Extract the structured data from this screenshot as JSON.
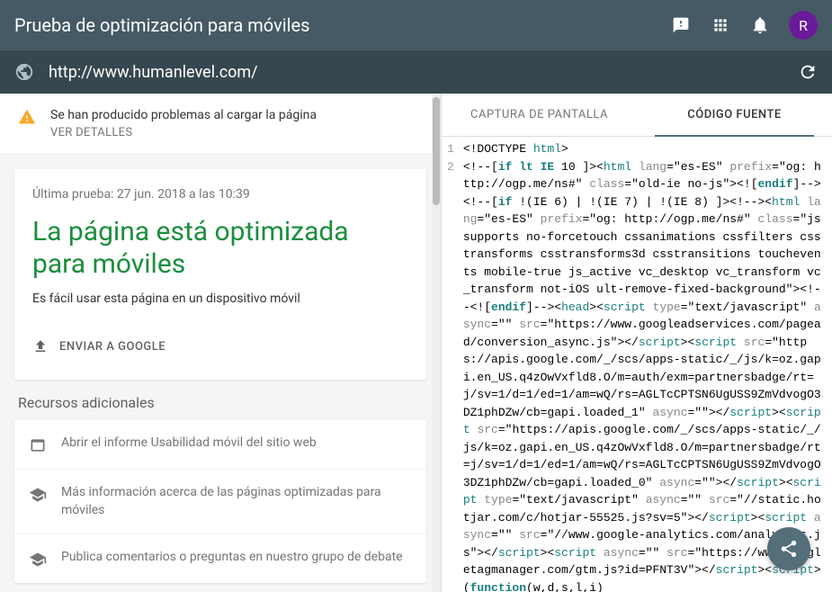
{
  "header": {
    "title": "Prueba de optimización para móviles",
    "avatar_letter": "R"
  },
  "url_bar": {
    "url": "http://www.humanlevel.com/"
  },
  "warning": {
    "message": "Se han producido problemas al cargar la página",
    "link": "VER DETALLES"
  },
  "result": {
    "timestamp": "Última prueba: 27 jun. 2018 a las 10:39",
    "title": "La página está optimizada para móviles",
    "description": "Es fácil usar esta página en un dispositivo móvil",
    "submit_label": "ENVIAR A GOOGLE"
  },
  "resources": {
    "title": "Recursos adicionales",
    "items": [
      "Abrir el informe Usabilidad móvil del sitio web",
      "Más información acerca de las páginas optimizadas para móviles",
      "Publica comentarios o preguntas en nuestro grupo de debate"
    ]
  },
  "tabs": {
    "screenshot": "CAPTURA DE PANTALLA",
    "source": "CÓDIGO FUENTE"
  },
  "code": {
    "lines": [
      "1",
      "2"
    ],
    "content_html": "&lt;!DOCTYPE <span class='tag'>html</span>&gt;<br>&lt;!--[<span class='keyword'>if lt IE</span> 10 ]&gt;&lt;<span class='tag'>html</span> <span class='attr'>lang</span>=\"es-ES\" <span class='attr'>prefix</span>=\"og: http://ogp.me/ns#\" <span class='attr'>class</span>=\"old-ie no-js\"&gt;&lt;![<span class='keyword'>endif</span>]--&gt;&lt;!--[<span class='keyword'>if</span> !(IE 6) | !(IE 7) | !(IE 8) ]&gt;&lt;!--&gt;&lt;<span class='tag'>html</span> <span class='attr'>lang</span>=\"es-ES\" <span class='attr'>prefix</span>=\"og: http://ogp.me/ns#\" <span class='attr'>class</span>=\"js supports no-forcetouch cssanimations cssfilters csstransforms csstransforms3d csstransitions touchevents mobile-true js_active vc_desktop vc_transform vc_transform not-iOS ult-remove-fixed-background\"&gt;&lt;!--&lt;![<span class='keyword'>endif</span>]--&gt;&lt;<span class='tag'>head</span>&gt;&lt;<span class='tag'>script</span> <span class='attr'>type</span>=\"text/javascript\" <span class='attr'>async</span>=\"\" <span class='attr'>src</span>=\"https://www.googleadservices.com/pagead/conversion_async.js\"&gt;&lt;/<span class='tag'>script</span>&gt;&lt;<span class='tag'>script</span> <span class='attr'>src</span>=\"https://apis.google.com/_/scs/apps-static/_/js/k=oz.gapi.en_US.q4zOwVxfld8.O/m=auth/exm=partnersbadge/rt=j/sv=1/d=1/ed=1/am=wQ/rs=AGLTcCPTSN6UgUSS9ZmVdvogO3DZ1phDZw/cb=gapi.loaded_1\" <span class='attr'>async</span>=\"\"&gt;&lt;/<span class='tag'>script</span>&gt;&lt;<span class='tag'>script</span> <span class='attr'>src</span>=\"https://apis.google.com/_/scs/apps-static/_/js/k=oz.gapi.en_US.q4zOwVxfld8.O/m=partnersbadge/rt=j/sv=1/d=1/ed=1/am=wQ/rs=AGLTcCPTSN6UgUSS9ZmVdvogO3DZ1phDZw/cb=gapi.loaded_0\" <span class='attr'>async</span>=\"\"&gt;&lt;/<span class='tag'>script</span>&gt;&lt;<span class='tag'>script</span> <span class='attr'>type</span>=\"text/javascript\" <span class='attr'>async</span>=\"\" <span class='attr'>src</span>=\"//static.hotjar.com/c/hotjar-55525.js?sv=5\"&gt;&lt;/<span class='tag'>script</span>&gt;&lt;<span class='tag'>script</span> <span class='attr'>async</span>=\"\" <span class='attr'>src</span>=\"//www.google-analytics.com/analytics.js\"&gt;&lt;/<span class='tag'>script</span>&gt;&lt;<span class='tag'>script</span> <span class='attr'>async</span>=\"\" <span class='attr'>src</span>=\"https://www.googletagmanager.com/gtm.js?id=PFNT3V\"&gt;&lt;/<span class='tag'>script</span>&gt;&lt;<span class='tag'>script</span>&gt;(<span class='keyword'>function</span>(w,d,s,l,i)"
  }
}
